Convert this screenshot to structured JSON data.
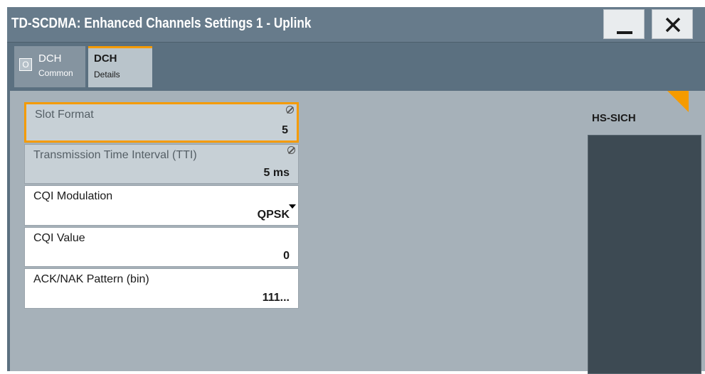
{
  "window": {
    "title": "TD-SCDMA: Enhanced Channels Settings 1 - Uplink",
    "minimize_icon": "minimize-icon",
    "close_icon": "close-icon"
  },
  "tabs": [
    {
      "line1": "DCH",
      "line2": "Common",
      "led": "O",
      "active": false
    },
    {
      "line1": "DCH",
      "line2": "Details",
      "active": true
    }
  ],
  "fields": {
    "slot_format": {
      "label": "Slot Format",
      "value": "5"
    },
    "tti": {
      "label": "Transmission Time Interval (TTI)",
      "value": "5 ms"
    },
    "cqi_modulation": {
      "label": "CQI Modulation",
      "value": "QPSK"
    },
    "cqi_value": {
      "label": "CQI Value",
      "value": "0"
    },
    "ack_nak": {
      "label": "ACK/NAK Pattern (bin)",
      "value": "111..."
    }
  },
  "hs_sich": {
    "label": "HS-SICH"
  },
  "colors": {
    "accent": "#f59b00",
    "titlebar": "#677b8b",
    "content": "#a6b1b9"
  }
}
